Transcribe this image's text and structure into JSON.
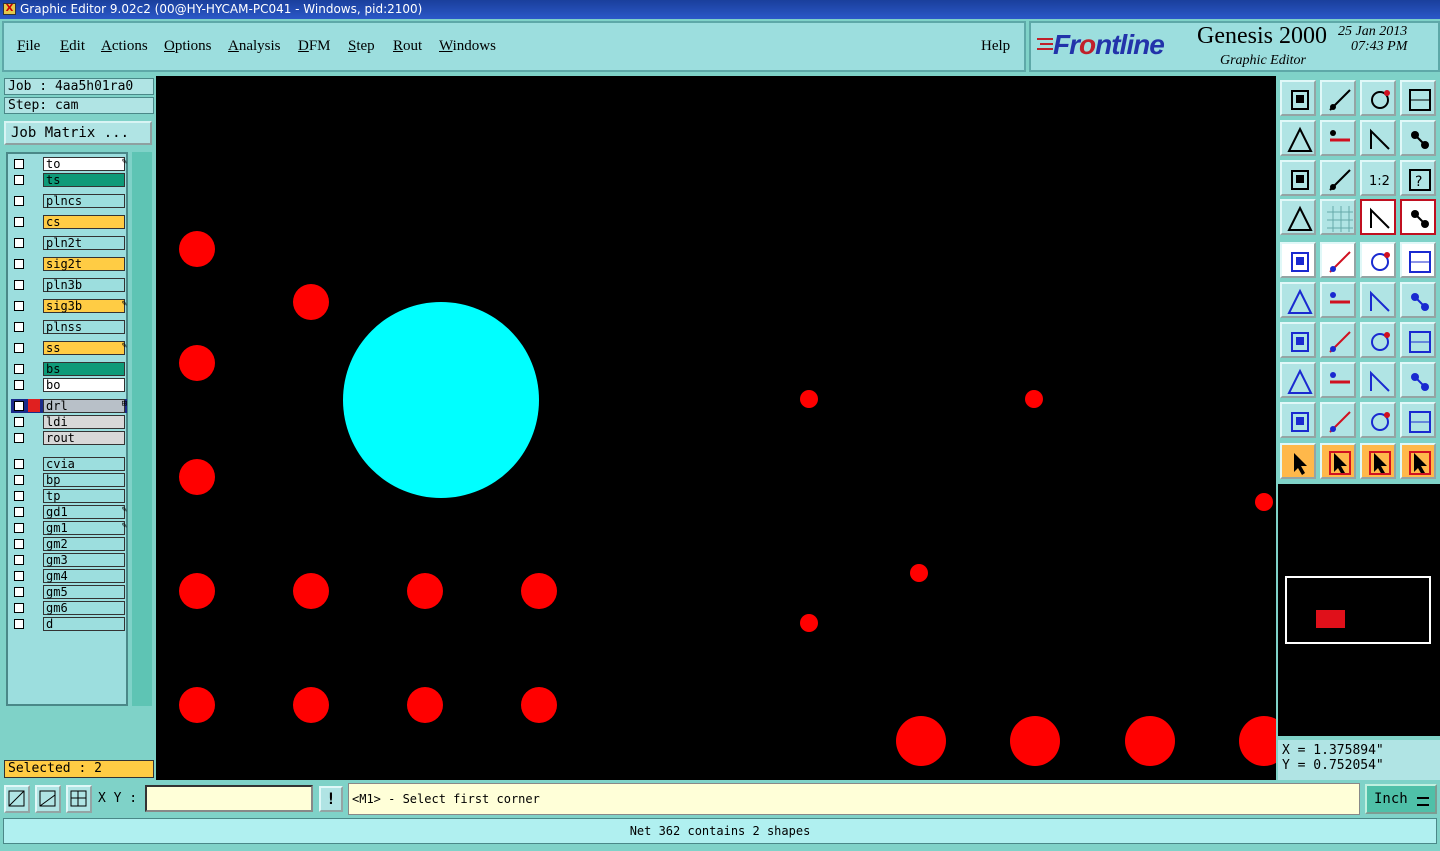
{
  "window": {
    "title": "Graphic Editor 9.02c2 (00@HY-HYCAM-PC041 - Windows, pid:2100)"
  },
  "menu": {
    "items": [
      {
        "label": "File",
        "ul": "F",
        "rest": "ile"
      },
      {
        "label": "Edit",
        "ul": "E",
        "rest": "dit"
      },
      {
        "label": "Actions",
        "ul": "A",
        "rest": "ctions"
      },
      {
        "label": "Options",
        "ul": "O",
        "rest": "ptions"
      },
      {
        "label": "Analysis",
        "ul": "A",
        "rest": "nalysis"
      },
      {
        "label": "DFM",
        "ul": "D",
        "rest": "FM"
      },
      {
        "label": "Step",
        "ul": "S",
        "rest": "tep"
      },
      {
        "label": "Rout",
        "ul": "R",
        "rest": "out"
      },
      {
        "label": "Windows",
        "ul": "W",
        "rest": "indows"
      }
    ],
    "help": "Help"
  },
  "logo": {
    "brand_a": "Fr",
    "brand_o": "o",
    "brand_b": "ntline",
    "product": "Genesis 2000",
    "subtitle": "Graphic Editor",
    "date": "25 Jan 2013",
    "time": "07:43 PM"
  },
  "job": {
    "job_line": "Job : 4aa5h01ra0",
    "step_line": "Step: cam",
    "matrix_button": "Job Matrix ..."
  },
  "layers": [
    {
      "name": "to",
      "color": "#ffffff",
      "flag": "✎"
    },
    {
      "name": "ts",
      "color": "#0e9a78",
      "flag": ""
    },
    {
      "name": "plncs",
      "color": "#9cdede",
      "flag": ""
    },
    {
      "name": "cs",
      "color": "#ffcc44",
      "flag": ""
    },
    {
      "name": "pln2t",
      "color": "#9cdede",
      "flag": ""
    },
    {
      "name": "sig2t",
      "color": "#ffcc44",
      "flag": ""
    },
    {
      "name": "pln3b",
      "color": "#9cdede",
      "flag": ""
    },
    {
      "name": "sig3b",
      "color": "#ffcc44",
      "flag": "✎"
    },
    {
      "name": "plnss",
      "color": "#9cdede",
      "flag": ""
    },
    {
      "name": "ss",
      "color": "#ffcc44",
      "flag": "✎"
    },
    {
      "name": "bs",
      "color": "#0e9a78",
      "flag": ""
    },
    {
      "name": "bo",
      "color": "#ffffff",
      "flag": ""
    },
    {
      "name": "drl",
      "color": "#b8c0c8",
      "flag": "⊞",
      "active": true
    },
    {
      "name": "ldi",
      "color": "#d8d8d8",
      "flag": ""
    },
    {
      "name": "rout",
      "color": "#d8d8d8",
      "flag": ""
    },
    {
      "name": "cvia",
      "color": "#9cdede",
      "flag": ""
    },
    {
      "name": "bp",
      "color": "#9cdede",
      "flag": ""
    },
    {
      "name": "tp",
      "color": "#9cdede",
      "flag": ""
    },
    {
      "name": "gd1",
      "color": "#9cdede",
      "flag": "✎"
    },
    {
      "name": "gm1",
      "color": "#9cdede",
      "flag": "✎"
    },
    {
      "name": "gm2",
      "color": "#9cdede",
      "flag": ""
    },
    {
      "name": "gm3",
      "color": "#9cdede",
      "flag": ""
    },
    {
      "name": "gm4",
      "color": "#9cdede",
      "flag": ""
    },
    {
      "name": "gm5",
      "color": "#9cdede",
      "flag": ""
    },
    {
      "name": "gm6",
      "color": "#9cdede",
      "flag": ""
    },
    {
      "name": "d",
      "color": "#9cdede",
      "flag": ""
    }
  ],
  "selected_text": "Selected : 2",
  "coords": {
    "x": "X = 1.375894\"",
    "y": "Y = 0.752054\""
  },
  "command": {
    "xy_label": "X Y :",
    "xy_value": "",
    "excl": "!",
    "prompt": "<M1> - Select first corner",
    "unit": "Inch"
  },
  "status": "Net 362 contains 2 shapes",
  "colors": {
    "pad": "#ff0000",
    "highlight": "#00ffff",
    "canvas": "#000000"
  },
  "toolbar_icons": [
    [
      "zoom-home-icon",
      "zoom-back-icon",
      "home-view-icon",
      "panel-split-icon"
    ],
    [
      "zoom-out-icon",
      "zoom-in-icon",
      "undo-view-icon",
      "snake-icon"
    ],
    [
      "fit-all-icon",
      "pan-center-icon",
      "scale-1-2-icon",
      "help-query-icon"
    ],
    [
      "tools-icon",
      "grid-icon",
      "net-connect-icon",
      "net-mode-icon"
    ],
    [
      "display-fill-icon",
      "outline-icon",
      "ruler-icon",
      "pad-solid-icon"
    ],
    [
      "connect-nodes-icon",
      "cross-icon",
      "arrow-node-icon",
      "node-move-icon"
    ],
    [
      "line-angle-icon",
      "line-draw-icon",
      "arc-icon",
      "mirror-icon"
    ],
    [
      "pad-add-icon",
      "line-horizontal-icon",
      "measure-icon",
      "shapes-icon"
    ],
    [
      "triangle-icon",
      "polygon-icon",
      "trapezoid-icon",
      "contour-icon"
    ],
    [
      "select-pointer-icon",
      "select-box-icon",
      "select-highlight-icon",
      "select-route-icon"
    ]
  ]
}
